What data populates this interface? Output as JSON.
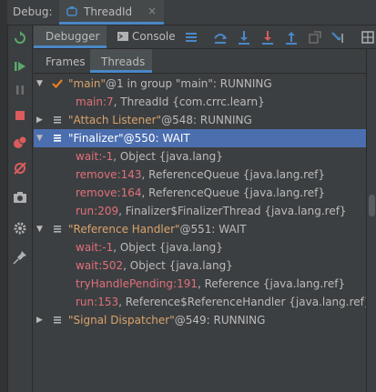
{
  "header": {
    "debug_label": "Debug:",
    "tab_label": "ThreadId",
    "tab_close": "×"
  },
  "toolbar": {
    "debugger_label": "Debugger",
    "console_label": "Console"
  },
  "subtabs": {
    "frames_label": "Frames",
    "threads_label": "Threads",
    "active": "Threads"
  },
  "colors": {
    "accent": "#4a88c7",
    "selection": "#4b6eaf",
    "background": "#3c3f41",
    "frame_method": "#e0707a",
    "thread_name": "#d9a36c"
  },
  "threads": [
    {
      "expanded": true,
      "icon": "running-check-icon",
      "name": "\"main\"",
      "rest": "@1 in group \"main\": RUNNING",
      "selected": false,
      "frames": [
        {
          "method": "main:7",
          "rest": ", ThreadId {com.crrc.learn}"
        }
      ]
    },
    {
      "expanded": false,
      "icon": "thread-icon",
      "name": "\"Attach Listener\"",
      "rest": "@548: RUNNING",
      "selected": false,
      "frames": []
    },
    {
      "expanded": true,
      "icon": "thread-icon",
      "name": "\"Finalizer\"",
      "rest": "@550: WAIT",
      "selected": true,
      "frames": [
        {
          "method": "wait:-1",
          "rest": ", Object {java.lang}"
        },
        {
          "method": "remove:143",
          "rest": ", ReferenceQueue {java.lang.ref}"
        },
        {
          "method": "remove:164",
          "rest": ", ReferenceQueue {java.lang.ref}"
        },
        {
          "method": "run:209",
          "rest": ", Finalizer$FinalizerThread {java.lang.ref}"
        }
      ]
    },
    {
      "expanded": true,
      "icon": "thread-icon",
      "name": "\"Reference Handler\"",
      "rest": "@551: WAIT",
      "selected": false,
      "frames": [
        {
          "method": "wait:-1",
          "rest": ", Object {java.lang}"
        },
        {
          "method": "wait:502",
          "rest": ", Object {java.lang}"
        },
        {
          "method": "tryHandlePending:191",
          "rest": ", Reference {java.lang.ref}"
        },
        {
          "method": "run:153",
          "rest": ", Reference$ReferenceHandler {java.lang.ref}"
        }
      ]
    },
    {
      "expanded": false,
      "icon": "thread-icon",
      "name": "\"Signal Dispatcher\"",
      "rest": "@549: RUNNING",
      "selected": false,
      "frames": []
    }
  ]
}
